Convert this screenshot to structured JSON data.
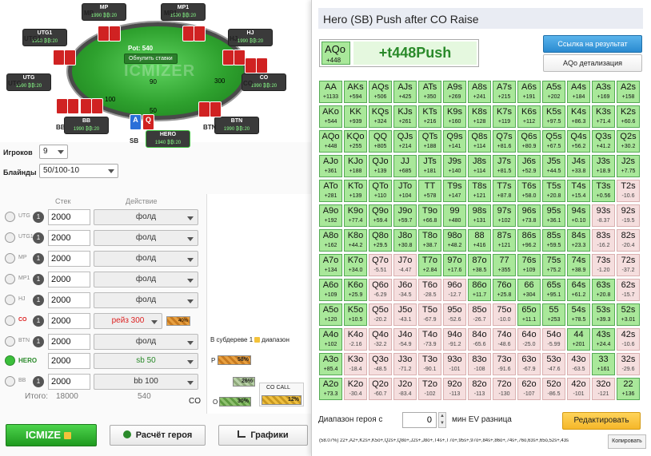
{
  "table": {
    "pot_label": "Pot: 540",
    "reset_label": "Обнулить ставки",
    "watermark": "ICMIZER",
    "bets": {
      "left": "100",
      "top": "90",
      "right": "300",
      "bottom": "50"
    },
    "seats": [
      {
        "id": "MP",
        "label": "MP",
        "name": "MP",
        "stack": "1990 ₿₿:20"
      },
      {
        "id": "MP1",
        "label": "MP1",
        "name": "MP1",
        "stack": "1990 ₿₿:20"
      },
      {
        "id": "UTG1",
        "label": "UTG1",
        "name": "UTG1",
        "stack": "1990 ₿₿:20"
      },
      {
        "id": "HJ",
        "label": "HJ",
        "name": "HJ",
        "stack": "1990 ₿₿:20"
      },
      {
        "id": "UTG",
        "label": "UTG",
        "name": "UTG",
        "stack": "1990 ₿₿:20"
      },
      {
        "id": "CO",
        "label": "CO",
        "name": "CO",
        "stack": "1990 ₿₿:20"
      },
      {
        "id": "BB",
        "label": "BB",
        "name": "BB",
        "stack": "1990 ₿₿:20"
      },
      {
        "id": "BTN",
        "label": "BTN",
        "name": "BTN",
        "stack": "1990 ₿₿:20"
      },
      {
        "id": "SB",
        "label": "SB",
        "name": "HERO",
        "stack": "1940 ₿₿:20"
      }
    ],
    "hero_cards": [
      "A",
      "Q"
    ]
  },
  "settings": {
    "players_label": "Игроков",
    "players_value": "9",
    "blinds_label": "Блайнды",
    "blinds_value": "50/100-10",
    "stack_header": "Стек",
    "action_header": "Действие"
  },
  "positions": [
    {
      "name": "UTG",
      "stack": "2000",
      "action": "фолд"
    },
    {
      "name": "UTG1",
      "stack": "2000",
      "action": "фолд"
    },
    {
      "name": "MP",
      "stack": "2000",
      "action": "фолд"
    },
    {
      "name": "MP1",
      "stack": "2000",
      "action": "фолд"
    },
    {
      "name": "HJ",
      "stack": "2000",
      "action": "фолд"
    },
    {
      "name": "CO",
      "stack": "2000",
      "action": "рейз 300"
    },
    {
      "name": "BTN",
      "stack": "2000",
      "action": "фолд"
    },
    {
      "name": "HERO",
      "stack": "2000",
      "action": "sb 50"
    },
    {
      "name": "BB",
      "stack": "2000",
      "action": "bb 100"
    }
  ],
  "co_pct": "40%",
  "totals": {
    "label": "Итого:",
    "stack": "18000",
    "action": "540"
  },
  "subtree": {
    "title": "В субдереве 1",
    "suffix": "диапазон",
    "p_label": "P",
    "p_pct": "58%",
    "mid_pct": "26%",
    "o_label": "O",
    "o_pct": "30%",
    "co_call_label": "CO CALL",
    "co_call_pct": "12%",
    "co_label": "CO"
  },
  "buttons": {
    "icmize": "ICMIZE",
    "hero_calc": "Расчёт героя",
    "charts": "Графики",
    "link": "Ссылка на результат",
    "detail": "AQo детализация",
    "edit": "Редактировать",
    "copy": "Копировать"
  },
  "result": {
    "title": "Hero (SB) Push after CO Raise",
    "hand": "AQo",
    "hand_ev": "+448",
    "headline": "+t448Push"
  },
  "range": {
    "label_prefix": "Диапазон героя с",
    "value": "0",
    "label_suffix": "мин EV разница",
    "string": "(58.07%) 22+,A2+,K2s+,K5o+,Q2s+,Q8o+,J2s+,J8o+,T4s+,T7o+,95s+,97o+,84s+,86o+,74s+,76o,63s+,65o,52s+,43s"
  },
  "grid": [
    [
      [
        "AA",
        "+1133",
        1
      ],
      [
        "AKs",
        "+594",
        1
      ],
      [
        "AQs",
        "+506",
        1
      ],
      [
        "AJs",
        "+425",
        1
      ],
      [
        "ATs",
        "+350",
        1
      ],
      [
        "A9s",
        "+269",
        1
      ],
      [
        "A8s",
        "+241",
        1
      ],
      [
        "A7s",
        "+215",
        1
      ],
      [
        "A6s",
        "+191",
        1
      ],
      [
        "A5s",
        "+202",
        1
      ],
      [
        "A4s",
        "+184",
        1
      ],
      [
        "A3s",
        "+169",
        1
      ],
      [
        "A2s",
        "+158",
        1
      ]
    ],
    [
      [
        "AKo",
        "+544",
        1
      ],
      [
        "KK",
        "+939",
        1
      ],
      [
        "KQs",
        "+324",
        1
      ],
      [
        "KJs",
        "+261",
        1
      ],
      [
        "KTs",
        "+216",
        1
      ],
      [
        "K9s",
        "+160",
        1
      ],
      [
        "K8s",
        "+128",
        1
      ],
      [
        "K7s",
        "+119",
        1
      ],
      [
        "K6s",
        "+112",
        1
      ],
      [
        "K5s",
        "+97.5",
        1
      ],
      [
        "K4s",
        "+86.3",
        1
      ],
      [
        "K3s",
        "+71.4",
        1
      ],
      [
        "K2s",
        "+60.6",
        1
      ]
    ],
    [
      [
        "AQo",
        "+448",
        1
      ],
      [
        "KQo",
        "+255",
        1
      ],
      [
        "QQ",
        "+805",
        1
      ],
      [
        "QJs",
        "+214",
        1
      ],
      [
        "QTs",
        "+188",
        1
      ],
      [
        "Q9s",
        "+141",
        1
      ],
      [
        "Q8s",
        "+114",
        1
      ],
      [
        "Q7s",
        "+81.6",
        1
      ],
      [
        "Q6s",
        "+80.9",
        1
      ],
      [
        "Q5s",
        "+67.5",
        1
      ],
      [
        "Q4s",
        "+56.2",
        1
      ],
      [
        "Q3s",
        "+41.2",
        1
      ],
      [
        "Q2s",
        "+30.2",
        1
      ]
    ],
    [
      [
        "AJo",
        "+361",
        1
      ],
      [
        "KJo",
        "+188",
        1
      ],
      [
        "QJo",
        "+139",
        1
      ],
      [
        "JJ",
        "+685",
        1
      ],
      [
        "JTs",
        "+181",
        1
      ],
      [
        "J9s",
        "+140",
        1
      ],
      [
        "J8s",
        "+114",
        1
      ],
      [
        "J7s",
        "+81.5",
        1
      ],
      [
        "J6s",
        "+52.9",
        1
      ],
      [
        "J5s",
        "+44.5",
        1
      ],
      [
        "J4s",
        "+33.8",
        1
      ],
      [
        "J3s",
        "+18.9",
        1
      ],
      [
        "J2s",
        "+7.75",
        1
      ]
    ],
    [
      [
        "ATo",
        "+281",
        1
      ],
      [
        "KTo",
        "+139",
        1
      ],
      [
        "QTo",
        "+110",
        1
      ],
      [
        "JTo",
        "+104",
        1
      ],
      [
        "TT",
        "+578",
        1
      ],
      [
        "T9s",
        "+147",
        1
      ],
      [
        "T8s",
        "+121",
        1
      ],
      [
        "T7s",
        "+87.8",
        1
      ],
      [
        "T6s",
        "+58.0",
        1
      ],
      [
        "T5s",
        "+20.8",
        1
      ],
      [
        "T4s",
        "+15.4",
        1
      ],
      [
        "T3s",
        "+0.56",
        1
      ],
      [
        "T2s",
        "-10.6",
        0
      ]
    ],
    [
      [
        "A9o",
        "+192",
        1
      ],
      [
        "K9o",
        "+77.4",
        1
      ],
      [
        "Q9o",
        "+59.4",
        1
      ],
      [
        "J9o",
        "+59.7",
        1
      ],
      [
        "T9o",
        "+66.8",
        1
      ],
      [
        "99",
        "+480",
        1
      ],
      [
        "98s",
        "+131",
        1
      ],
      [
        "97s",
        "+102",
        1
      ],
      [
        "96s",
        "+73.8",
        1
      ],
      [
        "95s",
        "+36.1",
        1
      ],
      [
        "94s",
        "+0.10",
        1
      ],
      [
        "93s",
        "-8.37",
        0
      ],
      [
        "92s",
        "-19.5",
        0
      ]
    ],
    [
      [
        "A8o",
        "+162",
        1
      ],
      [
        "K8o",
        "+44.2",
        1
      ],
      [
        "Q8o",
        "+29.5",
        1
      ],
      [
        "J8o",
        "+30.8",
        1
      ],
      [
        "T8o",
        "+38.7",
        1
      ],
      [
        "98o",
        "+48.2",
        1
      ],
      [
        "88",
        "+416",
        1
      ],
      [
        "87s",
        "+121",
        1
      ],
      [
        "86s",
        "+96.2",
        1
      ],
      [
        "85s",
        "+59.5",
        1
      ],
      [
        "84s",
        "+23.3",
        1
      ],
      [
        "83s",
        "-16.2",
        0
      ],
      [
        "82s",
        "-20.4",
        0
      ]
    ],
    [
      [
        "A7o",
        "+134",
        1
      ],
      [
        "K7o",
        "+34.0",
        1
      ],
      [
        "Q7o",
        "-5.51",
        0
      ],
      [
        "J7o",
        "-4.47",
        0
      ],
      [
        "T7o",
        "+2.84",
        1
      ],
      [
        "97o",
        "+17.6",
        1
      ],
      [
        "87o",
        "+38.5",
        1
      ],
      [
        "77",
        "+355",
        1
      ],
      [
        "76s",
        "+109",
        1
      ],
      [
        "75s",
        "+75.2",
        1
      ],
      [
        "74s",
        "+38.9",
        1
      ],
      [
        "73s",
        "-1.20",
        0
      ],
      [
        "72s",
        "-37.2",
        0
      ]
    ],
    [
      [
        "A6o",
        "+109",
        1
      ],
      [
        "K6o",
        "+25.9",
        1
      ],
      [
        "Q6o",
        "-6.29",
        0
      ],
      [
        "J6o",
        "-34.5",
        0
      ],
      [
        "T6o",
        "-28.5",
        0
      ],
      [
        "96o",
        "-12.7",
        0
      ],
      [
        "86o",
        "+11.7",
        1
      ],
      [
        "76o",
        "+25.8",
        1
      ],
      [
        "66",
        "+304",
        1
      ],
      [
        "65s",
        "+95.1",
        1
      ],
      [
        "64s",
        "+61.2",
        1
      ],
      [
        "63s",
        "+20.8",
        1
      ],
      [
        "62s",
        "-15.7",
        0
      ]
    ],
    [
      [
        "A5o",
        "+120",
        1
      ],
      [
        "K5o",
        "+10.5",
        1
      ],
      [
        "Q5o",
        "-20.2",
        0
      ],
      [
        "J5o",
        "-43.1",
        0
      ],
      [
        "T5o",
        "-67.9",
        0
      ],
      [
        "95o",
        "-52.6",
        0
      ],
      [
        "85o",
        "-26.7",
        0
      ],
      [
        "75o",
        "-10.0",
        0
      ],
      [
        "65o",
        "+11.1",
        1
      ],
      [
        "55",
        "+253",
        1
      ],
      [
        "54s",
        "+78.5",
        1
      ],
      [
        "53s",
        "+39.3",
        1
      ],
      [
        "52s",
        "+3.01",
        1
      ]
    ],
    [
      [
        "A4o",
        "+102",
        1
      ],
      [
        "K4o",
        "-2.16",
        0
      ],
      [
        "Q4o",
        "-32.2",
        0
      ],
      [
        "J4o",
        "-54.9",
        0
      ],
      [
        "T4o",
        "-73.9",
        0
      ],
      [
        "94o",
        "-91.2",
        0
      ],
      [
        "84o",
        "-65.6",
        0
      ],
      [
        "74o",
        "-48.6",
        0
      ],
      [
        "64o",
        "-25.0",
        0
      ],
      [
        "54o",
        "-5.99",
        0
      ],
      [
        "44",
        "+201",
        1
      ],
      [
        "43s",
        "+24.4",
        1
      ],
      [
        "42s",
        "-10.6",
        0
      ]
    ],
    [
      [
        "A3o",
        "+85.4",
        1
      ],
      [
        "K3o",
        "-18.4",
        0
      ],
      [
        "Q3o",
        "-48.5",
        0
      ],
      [
        "J3o",
        "-71.2",
        0
      ],
      [
        "T3o",
        "-90.1",
        0
      ],
      [
        "93o",
        "-101",
        0
      ],
      [
        "83o",
        "-108",
        0
      ],
      [
        "73o",
        "-91.6",
        0
      ],
      [
        "63o",
        "-67.9",
        0
      ],
      [
        "53o",
        "-47.6",
        0
      ],
      [
        "43o",
        "-63.5",
        0
      ],
      [
        "33",
        "+161",
        1
      ],
      [
        "32s",
        "-29.6",
        0
      ]
    ],
    [
      [
        "A2o",
        "+73.3",
        1
      ],
      [
        "K2o",
        "-30.4",
        0
      ],
      [
        "Q2o",
        "-60.7",
        0
      ],
      [
        "J2o",
        "-83.4",
        0
      ],
      [
        "T2o",
        "-102",
        0
      ],
      [
        "92o",
        "-113",
        0
      ],
      [
        "82o",
        "-113",
        0
      ],
      [
        "72o",
        "-130",
        0
      ],
      [
        "62o",
        "-107",
        0
      ],
      [
        "52o",
        "-86.5",
        0
      ],
      [
        "42o",
        "-101",
        0
      ],
      [
        "32o",
        "-121",
        0
      ],
      [
        "22",
        "+136",
        1
      ]
    ]
  ]
}
